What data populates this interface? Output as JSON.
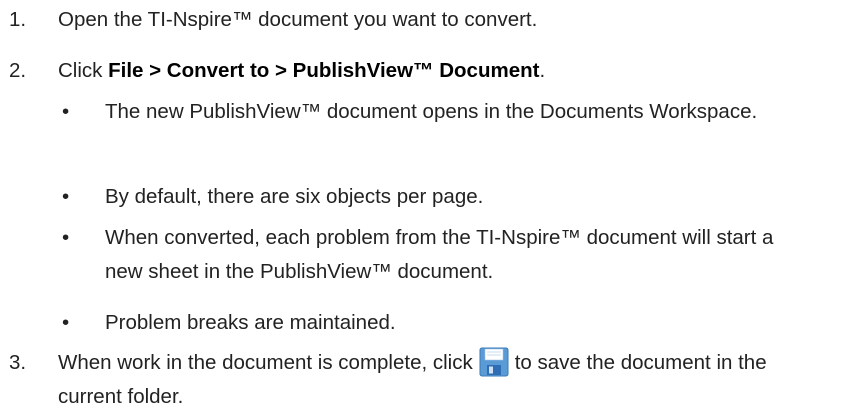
{
  "steps": [
    {
      "number": "1.",
      "text": "Open the TI-Nspire™ document you want to convert."
    },
    {
      "number": "2.",
      "prefix": "Click ",
      "bold": "File > Convert to > PublishView™ Document",
      "suffix": ".",
      "bullets": [
        "The new PublishView™ document opens in the Documents Workspace.",
        "By default, there are six objects per page.",
        "When converted, each problem from the TI-Nspire™ document will start a new sheet in the PublishView™ document.",
        "Problem breaks are maintained."
      ]
    },
    {
      "number": "3.",
      "before_icon": "When work in the document is complete, click",
      "icon": "save-icon",
      "after_icon": "to save the document in the current folder."
    }
  ],
  "bullet_symbol": "•",
  "colors": {
    "text": "#222222",
    "icon_body": "#5b9bd5",
    "icon_label": "#ffffff",
    "icon_shutter": "#2f6db5"
  }
}
